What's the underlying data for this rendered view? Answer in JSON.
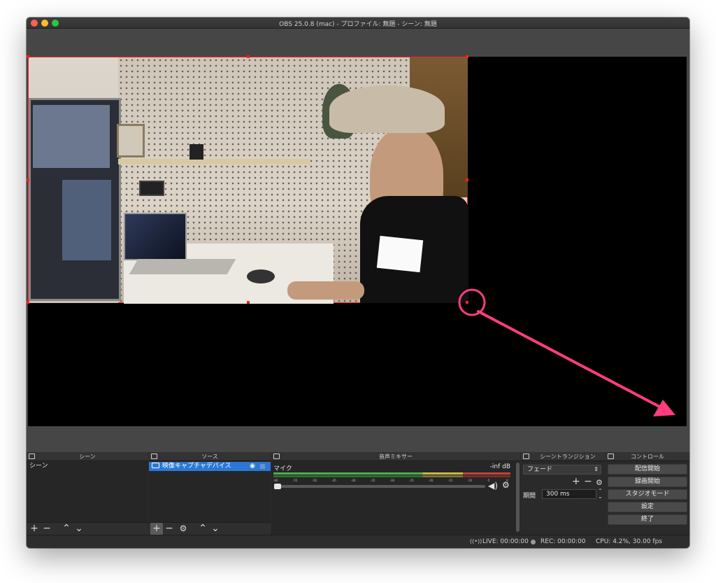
{
  "window": {
    "title": "OBS 25.0.8 (mac) - プロファイル: 無題 - シーン: 無題"
  },
  "scenes": {
    "title": "シーン",
    "items": [
      "シーン"
    ]
  },
  "sources": {
    "title": "ソース",
    "items": [
      "映像キャプチャデバイス"
    ]
  },
  "mixer": {
    "title": "音声ミキサー",
    "channel_name": "マイク",
    "level": "-inf dB",
    "ticks": [
      "-60",
      "-55",
      "-50",
      "-45",
      "-40",
      "-35",
      "-30",
      "-25",
      "-20",
      "-15",
      "-10",
      "-5",
      "0"
    ],
    "volume_fraction": 0.0
  },
  "transitions": {
    "title": "シーントランジション",
    "selected": "フェード",
    "duration_label": "期間",
    "duration_value": "300 ms"
  },
  "controls": {
    "title": "コントロール",
    "start_streaming": "配信開始",
    "start_recording": "録画開始",
    "studio_mode": "スタジオモード",
    "settings": "設定",
    "exit": "終了"
  },
  "status": {
    "live": "LIVE: 00:00:00",
    "rec": "REC: 00:00:00",
    "cpu": "CPU: 4.2%, 30.00 fps"
  },
  "colors": {
    "selection_border": "#ff2020",
    "annotation": "#ff3d7f",
    "selected_item": "#2b78d4"
  },
  "icons": {
    "add": "+",
    "remove": "−",
    "up": "⌃",
    "down": "⌄",
    "gear": "⚙",
    "eye": "👁",
    "lock": "🔒",
    "speaker": "🔊"
  }
}
